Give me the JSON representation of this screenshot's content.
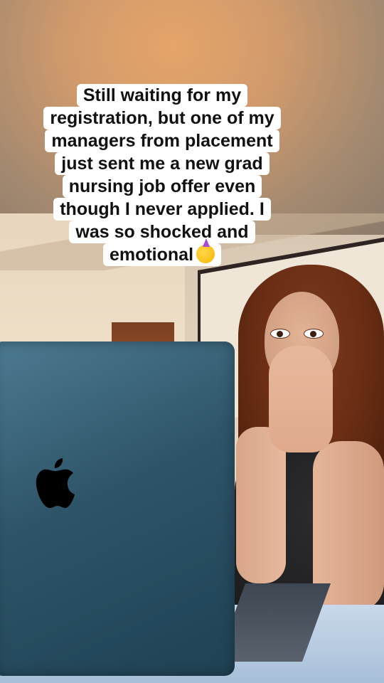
{
  "caption": {
    "lines": [
      "Still waiting for my",
      "registration, but one of my",
      "managers from placement",
      "just sent me a new grad",
      "nursing job offer even",
      "though I never applied. I",
      "was so shocked and",
      "emotional"
    ],
    "emoji": "partying-face-emoji"
  },
  "scene": {
    "laptop_logo": "apple-logo-icon",
    "colors": {
      "laptop": "#2e5468",
      "caption_bg": "#ffffff",
      "caption_text": "#111111"
    }
  }
}
